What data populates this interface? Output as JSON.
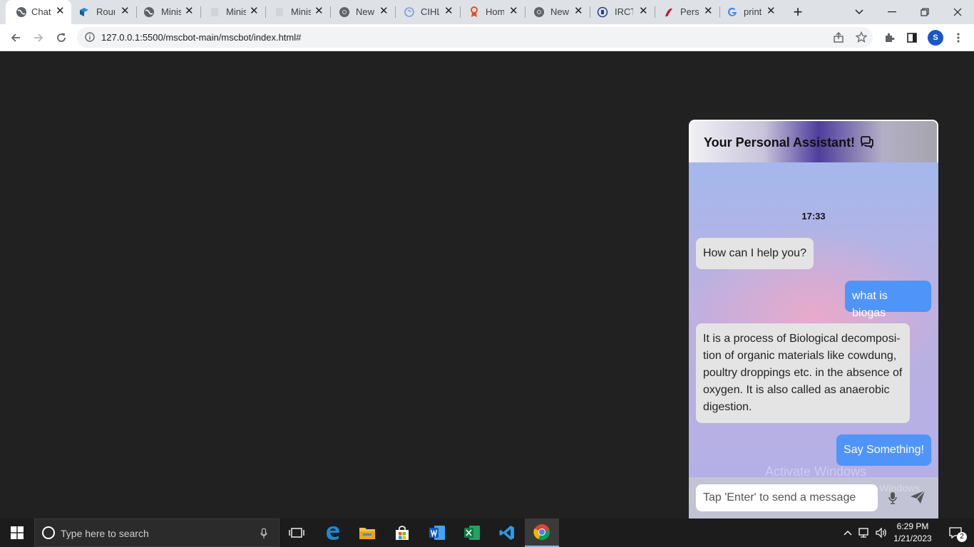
{
  "browser": {
    "tabs": [
      {
        "title": "Chat",
        "icon": "globe-icon",
        "active": true
      },
      {
        "title": "Roun",
        "icon": "round-logo-icon"
      },
      {
        "title": "Minis",
        "icon": "globe-icon"
      },
      {
        "title": "Minis",
        "icon": "page-icon"
      },
      {
        "title": "Minis",
        "icon": "page-icon"
      },
      {
        "title": "New",
        "icon": "chrome-icon"
      },
      {
        "title": "CIHL",
        "icon": "circle-icon"
      },
      {
        "title": "Hom",
        "icon": "pin-icon"
      },
      {
        "title": "New",
        "icon": "chrome-icon"
      },
      {
        "title": "IRCT",
        "icon": "irctc-icon"
      },
      {
        "title": "Pers",
        "icon": "red-logo-icon"
      },
      {
        "title": "print",
        "icon": "google-icon"
      }
    ],
    "new_tab_label": "+",
    "url": "127.0.0.1:5500/mscbot-main/mscbot/index.html#",
    "profile_initial": "S"
  },
  "chat": {
    "title": "Your Personal Assistant!",
    "timestamp": "17:33",
    "messages": [
      {
        "from": "bot",
        "text": "How can I help you?"
      },
      {
        "from": "user",
        "text": "what is biogas"
      },
      {
        "from": "bot",
        "text": "It is a process of Biological decomposi-tion of organic materials like cowdung, poultry droppings etc. in the absence of oxygen. It is also called as anaerobic digestion."
      },
      {
        "from": "user",
        "text": "Say Something!"
      }
    ],
    "input_placeholder": "Tap 'Enter' to send a message",
    "header_gradient_accent": "#4f3d9c",
    "user_bubble_color": "#4f94f8",
    "bot_bubble_color": "#e4e4e4"
  },
  "watermark": {
    "line1": "Activate Windows",
    "line2": "Go to Settings to activate Windows."
  },
  "taskbar": {
    "search_placeholder": "Type here to search",
    "time": "6:29 PM",
    "date": "1/21/2023",
    "notification_count": "2"
  }
}
